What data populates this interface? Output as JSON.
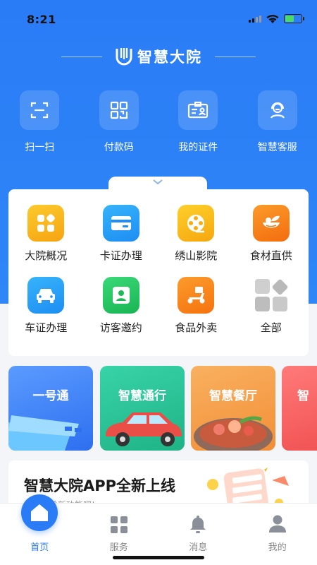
{
  "status_bar": {
    "time": "8:21"
  },
  "app": {
    "title": "智慧大院"
  },
  "quick_actions": [
    {
      "label": "扫一扫",
      "icon": "scan-icon"
    },
    {
      "label": "付款码",
      "icon": "qr-code-icon"
    },
    {
      "label": "我的证件",
      "icon": "id-card-icon"
    },
    {
      "label": "智慧客服",
      "icon": "customer-service-icon"
    }
  ],
  "services": [
    {
      "label": "大院概况",
      "icon": "overview-icon",
      "color": "#f7b617"
    },
    {
      "label": "卡证办理",
      "icon": "card-icon",
      "color": "#1e9ef5"
    },
    {
      "label": "绣山影院",
      "icon": "film-reel-icon",
      "color": "#f9b91b"
    },
    {
      "label": "食材直供",
      "icon": "vegetable-icon",
      "color": "#f97f12"
    },
    {
      "label": "车证办理",
      "icon": "car-icon",
      "color": "#1e9ef5"
    },
    {
      "label": "访客邀约",
      "icon": "visitor-icon",
      "color": "#22c25f"
    },
    {
      "label": "食品外卖",
      "icon": "scooter-icon",
      "color": "#fa8c17"
    },
    {
      "label": "全部",
      "icon": "all-icon",
      "color": "#c7c7c7"
    }
  ],
  "feature_cards": [
    {
      "label": "一号通",
      "color": "#3c7ff3"
    },
    {
      "label": "智慧通行",
      "color": "#2ecb9c"
    },
    {
      "label": "智慧餐厅",
      "color": "#f6a24a"
    },
    {
      "label": "智",
      "color": "#f56262"
    }
  ],
  "promo": {
    "title": "智慧大院APP全新上线",
    "subtitle": "快来体验新功能吧!"
  },
  "tab_bar": [
    {
      "label": "首页",
      "icon": "home-icon",
      "active": true
    },
    {
      "label": "服务",
      "icon": "grid-icon",
      "active": false
    },
    {
      "label": "消息",
      "icon": "bell-icon",
      "active": false
    },
    {
      "label": "我的",
      "icon": "user-icon",
      "active": false
    }
  ],
  "colors": {
    "primary": "#2a7cf6",
    "background": "#f3f5f9"
  }
}
